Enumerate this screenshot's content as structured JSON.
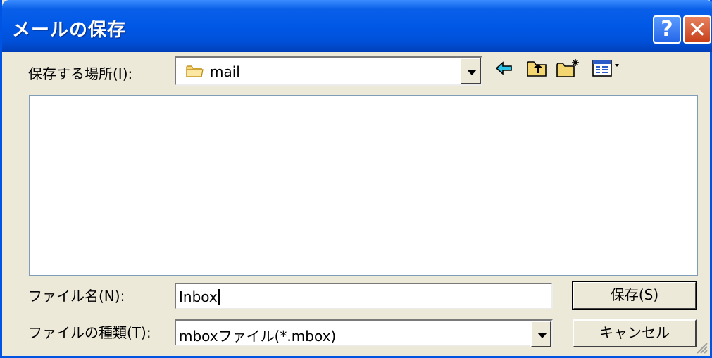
{
  "window": {
    "title": "メールの保存",
    "help_glyph": "?",
    "close_glyph": "✕"
  },
  "location": {
    "label": "保存する場所(I):",
    "value": "mail",
    "icon": "folder-icon"
  },
  "toolbar": {
    "icons": [
      "back-arrow-icon",
      "up-folder-icon",
      "new-folder-icon",
      "view-menu-icon"
    ]
  },
  "filename": {
    "label": "ファイル名(N):",
    "value": "Inbox"
  },
  "filetype": {
    "label": "ファイルの種類(T):",
    "value": "mboxファイル(*.mbox)"
  },
  "buttons": {
    "save": "保存(S)",
    "cancel": "キャンセル"
  },
  "colors": {
    "titlebar": "#0058E6",
    "dialog_bg": "#ECE9D8",
    "list_border": "#7F9DB9"
  }
}
